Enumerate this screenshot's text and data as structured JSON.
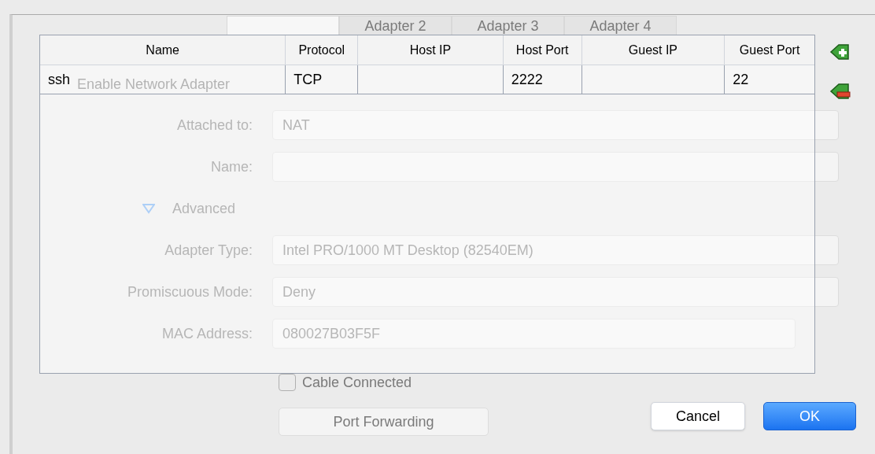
{
  "settings_panel": {
    "tabs": [
      {
        "selected": true
      },
      {
        "label": "Adapter 2",
        "selected": false
      },
      {
        "label": "Adapter 3",
        "selected": false
      },
      {
        "label": "Adapter 4",
        "selected": false
      }
    ],
    "enable_adapter": {
      "label": "Enable Network Adapter"
    },
    "fields": [
      {
        "kind": "select",
        "label": "Attached to:",
        "value": "NAT"
      },
      {
        "kind": "select",
        "label": "Name:"
      },
      {
        "kind": "disclosure",
        "label": "Advanced",
        "expanded": true
      },
      {
        "kind": "select",
        "label": "Adapter Type:",
        "value": "Intel PRO/1000 MT Desktop (82540EM)"
      },
      {
        "kind": "select",
        "label": "Promiscuous Mode:",
        "value": "Deny"
      },
      {
        "kind": "text",
        "label": "MAC Address:",
        "value": "080027B03F5F"
      },
      {
        "kind": "checkbox",
        "label": "Cable Connected",
        "checked": false
      },
      {
        "kind": "button",
        "label": "Port Forwarding"
      }
    ]
  },
  "port_forwarding": {
    "columns": [
      "Name",
      "Protocol",
      "Host IP",
      "Host Port",
      "Guest IP",
      "Guest Port"
    ],
    "rows": [
      {
        "cells": [
          "ssh",
          "TCP",
          null,
          "2222",
          null,
          "22"
        ],
        "selected": false
      }
    ],
    "buttons": [
      {
        "kind": "default",
        "label": "Cancel"
      },
      {
        "kind": "primary",
        "label": "OK"
      }
    ]
  }
}
